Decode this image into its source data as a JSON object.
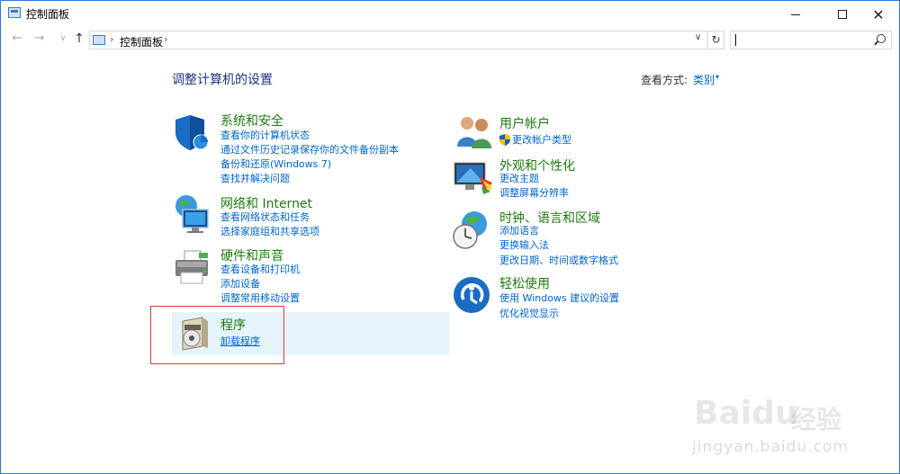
{
  "window": {
    "title": "控制面板",
    "minimize_glyph": "",
    "close_glyph": "✕"
  },
  "nav": {
    "back_glyph": "←",
    "forward_glyph": "→",
    "recent_glyph": "∨",
    "up_glyph": "↑",
    "breadcrumb_sep": "›",
    "breadcrumb": "控制面板",
    "dropdown_glyph": "∨",
    "refresh_glyph": "↻",
    "search_value": ""
  },
  "content": {
    "heading": "调整计算机的设置",
    "view_by_label": "查看方式:",
    "view_by_value": "类别",
    "view_by_caret": "▾"
  },
  "categories_left": [
    {
      "title": "系统和安全",
      "icon": "shield-icon",
      "links": [
        "查看你的计算机状态",
        "通过文件历史记录保存你的文件备份副本",
        "备份和还原(Windows 7)",
        "查找并解决问题"
      ]
    },
    {
      "title": "网络和 Internet",
      "icon": "network-globe-icon",
      "links": [
        "查看网络状态和任务",
        "选择家庭组和共享选项"
      ]
    },
    {
      "title": "硬件和声音",
      "icon": "printer-icon",
      "links": [
        "查看设备和打印机",
        "添加设备",
        "调整常用移动设置"
      ]
    },
    {
      "title": "程序",
      "icon": "programs-disc-icon",
      "links": [
        "卸载程序"
      ]
    }
  ],
  "categories_right": [
    {
      "title": "用户帐户",
      "icon": "users-icon",
      "links": [
        "更改帐户类型"
      ]
    },
    {
      "title": "外观和个性化",
      "icon": "monitor-colors-icon",
      "links": [
        "更改主题",
        "调整屏幕分辨率"
      ]
    },
    {
      "title": "时钟、语言和区域",
      "icon": "clock-globe-icon",
      "links": [
        "添加语言",
        "更换输入法",
        "更改日期、时间或数字格式"
      ]
    },
    {
      "title": "轻松使用",
      "icon": "ease-of-access-icon",
      "links": [
        "使用 Windows 建议的设置",
        "优化视觉显示"
      ]
    }
  ],
  "watermark": {
    "brand": "Bai",
    "brand2": "du",
    "cn": "经验",
    "url": "jingyan.baidu.com"
  },
  "colors": {
    "category_title": "#1e7b0f",
    "link": "#0066cc",
    "heading": "#1e3287",
    "highlight": "#e5f3fb",
    "annotation_box": "#e53935"
  }
}
